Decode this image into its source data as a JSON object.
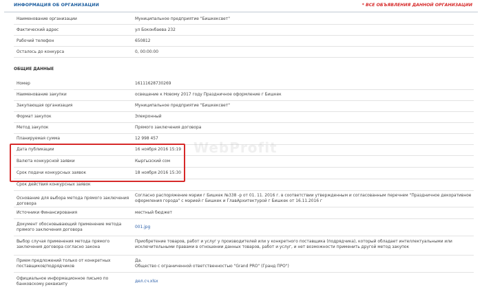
{
  "org_section": {
    "title": "ИНФОРМАЦИЯ ОБ ОРГАНИЗАЦИИ",
    "link": "* ВСЕ ОБЪЯВЛЕНИЯ ДАННОЙ ОРГАНИЗАЦИИ",
    "rows": [
      {
        "label": "Наименование организации",
        "value": "Муниципальное предприятие \"Бишкексвет\""
      },
      {
        "label": "Фактический адрес",
        "value": "ул Боконбаева 232"
      },
      {
        "label": "Рабочий телефон",
        "value": "650812"
      },
      {
        "label": "Осталось до конкурса",
        "value": "0, 00:00:00"
      }
    ]
  },
  "general_section": {
    "title": "ОБЩИЕ ДАННЫЕ",
    "rows": [
      {
        "label": "Номер",
        "value": "16111628730269"
      },
      {
        "label": "Наименование закупки",
        "value": "освещение к Новому 2017 году Праздничное оформление г Бишкек"
      },
      {
        "label": "Закупающая организация",
        "value": "Муниципальное предприятие \"Бишкексвет\""
      },
      {
        "label": "Формат закупок",
        "value": "Элекронный"
      },
      {
        "label": "Метод закупок",
        "value": "Прямого заключения договора"
      },
      {
        "label": "Планируемая сумма",
        "value": "12 998 457"
      },
      {
        "label": "Дата публикации",
        "value": "16 ноября 2016 15:19"
      },
      {
        "label": "Валюта конкурсной заявки",
        "value": "Кыргызский сом"
      },
      {
        "label": "Срок подачи конкурсных заявок",
        "value": "18 ноября 2016 15:30"
      },
      {
        "label": "Срок действия конкурсных заявок",
        "value": ""
      },
      {
        "label": "Основание для выбора метода прямого заключения договора",
        "value": "Согласно распоряжение мэрии г Бишкек №338 -р от 01. 11. 2016 г. в соответствии утвержденным и согласованным перечнем \"Праздничное декоративное оформления города\" с мэрией г Бишкек и ГлавАрхитектурой г Бишкек от 16.11.2016 г"
      },
      {
        "label": "Источники Финансирования",
        "value": "местный бюджет"
      },
      {
        "label": "Документ обосновывающий применение метода прямого заключения договора",
        "value": "001.jpg"
      },
      {
        "label": "Выбор случая применения метода прямого заключения договора согласно закона",
        "value": "Приобретение товаров, работ и услуг у производителей или у конкретного поставщика (подрядчика), который обладает интеллектуальными или исключительными правами в отношении данных товаров, работ и услуг, и нет возможности применить другой метод закупок"
      },
      {
        "label": "Прием предложений только от конкретных поставщиков/подрядчиков",
        "value": "Да.\nОбщество с ограниченной ответственностью \"Grand PRO\" (Гранд ПРО\")"
      },
      {
        "label": "Официальное информационное письмо по банковскому реквизиту",
        "value": "дел.сч.xlsx"
      }
    ]
  },
  "watermark": "WebProfit"
}
